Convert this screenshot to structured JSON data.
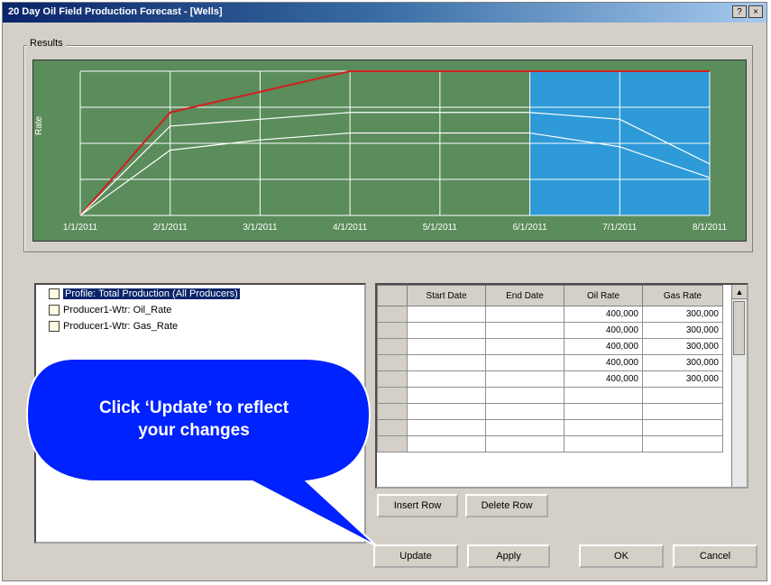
{
  "window": {
    "title": "20 Day Oil Field Production Forecast - [Wells]"
  },
  "group": {
    "label": "Results"
  },
  "chart": {
    "ylabel": "Rate"
  },
  "chart_data": {
    "type": "line",
    "x": [
      "1/1/2011",
      "2/1/2011",
      "3/1/2011",
      "4/1/2011",
      "5/1/2011",
      "6/1/2011",
      "7/1/2011",
      "8/1/2011"
    ],
    "series": [
      {
        "values": [
          0,
          60,
          72,
          84,
          84,
          84,
          84,
          84
        ],
        "color": "#d02020"
      },
      {
        "values": [
          0,
          52,
          56,
          60,
          60,
          60,
          56,
          30
        ],
        "color": "#ffffff"
      },
      {
        "values": [
          0,
          38,
          44,
          48,
          48,
          48,
          40,
          22
        ],
        "color": "#ffffff"
      }
    ],
    "ylim": [
      0,
      84
    ],
    "highlight_range": [
      "6/1/2011",
      "8/1/2011"
    ],
    "grid": true
  },
  "tree": {
    "items": [
      {
        "label": "Profile: Total Production (All Producers)"
      },
      {
        "label": "Producer1-Wtr: Oil_Rate"
      },
      {
        "label": "Producer1-Wtr: Gas_Rate"
      }
    ]
  },
  "grid": {
    "headers": [
      "",
      "Start Date",
      "End Date",
      "Oil Rate",
      "Gas Rate"
    ],
    "rows": [
      [
        "",
        "",
        "",
        "400,000",
        "300,000"
      ],
      [
        "",
        "",
        "",
        "400,000",
        "300,000"
      ],
      [
        "",
        "",
        "",
        "400,000",
        "300,000"
      ],
      [
        "",
        "",
        "",
        "400,000",
        "300,000"
      ],
      [
        "",
        "",
        "",
        "400,000",
        "300,000"
      ],
      [
        "",
        "",
        "",
        "",
        ""
      ],
      [
        "",
        "",
        "",
        "",
        ""
      ],
      [
        "",
        "",
        "",
        "",
        ""
      ],
      [
        "",
        "",
        "",
        "",
        ""
      ]
    ]
  },
  "buttons": {
    "insert_row": "Insert Row",
    "delete_row": "Delete Row",
    "update": "Update",
    "apply": "Apply",
    "ok": "OK",
    "cancel": "Cancel"
  },
  "callout": {
    "line1": "Click ‘Update’ to reflect",
    "line2": "your changes"
  }
}
